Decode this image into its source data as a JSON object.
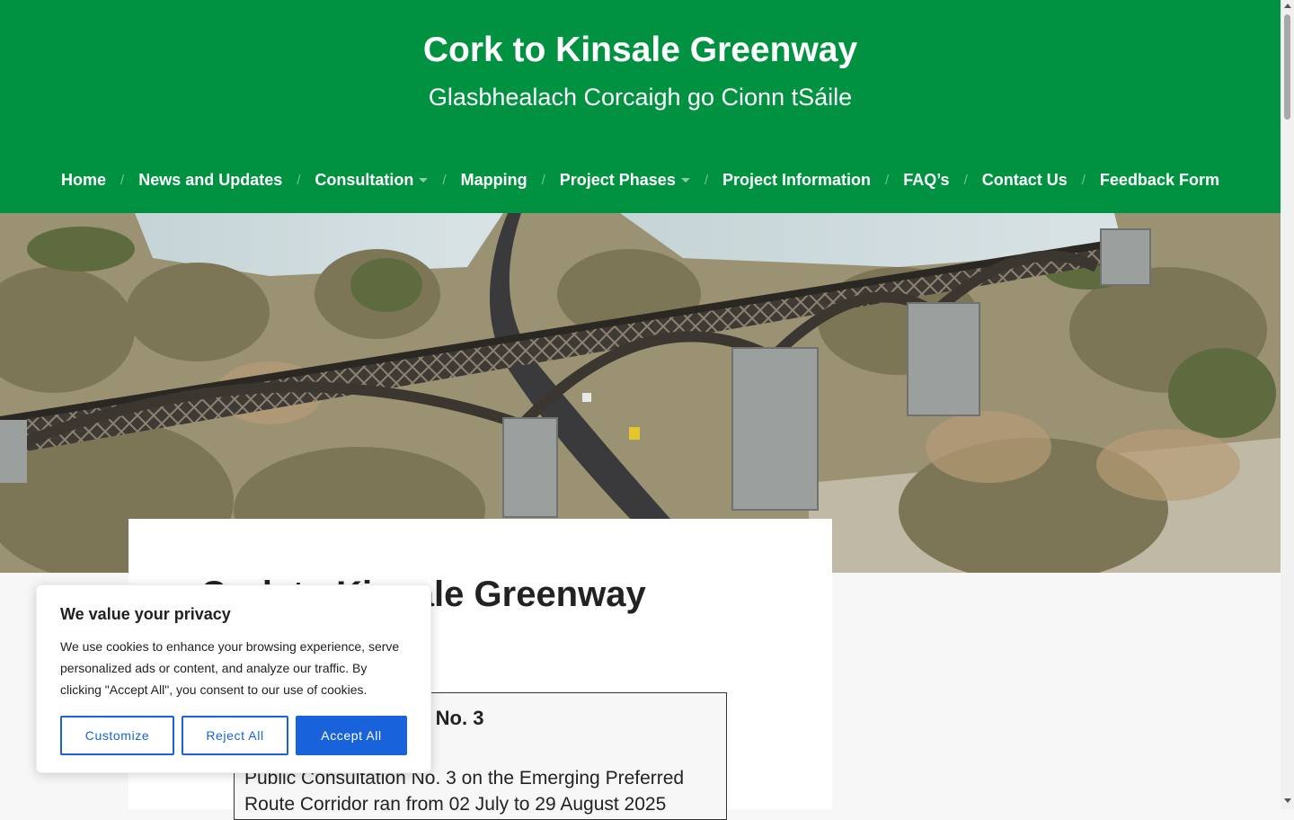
{
  "header": {
    "title": "Cork to Kinsale Greenway",
    "tagline": "Glasbhealach Corcaigh go Cionn tSáile",
    "background_color": "#009241"
  },
  "nav": {
    "separator": "/",
    "items": [
      {
        "label": "Home"
      },
      {
        "label": "News and Updates"
      },
      {
        "label": "Consultation",
        "has_dropdown": true
      },
      {
        "label": "Mapping"
      },
      {
        "label": "Project Phases",
        "has_dropdown": true
      },
      {
        "label": "Project Information"
      },
      {
        "label": "FAQ’s"
      },
      {
        "label": "Contact Us"
      },
      {
        "label": "Feedback Form"
      }
    ]
  },
  "content": {
    "heading": "Cork to Kinsale Greenway",
    "box_title": "Public Consultation No. 3",
    "box_text": "Public Consultation No. 3 on the Emerging Preferred Route Corridor ran from 02 July to 29 August 2025"
  },
  "cookie_banner": {
    "title": "We value your privacy",
    "text": "We use cookies to enhance your browsing experience, serve personalized ads or content, and analyze our traffic. By clicking \"Accept All\", you consent to our use of cookies.",
    "customize_label": "Customize",
    "reject_label": "Reject All",
    "accept_label": "Accept All",
    "accent_color": "#1863dc"
  }
}
